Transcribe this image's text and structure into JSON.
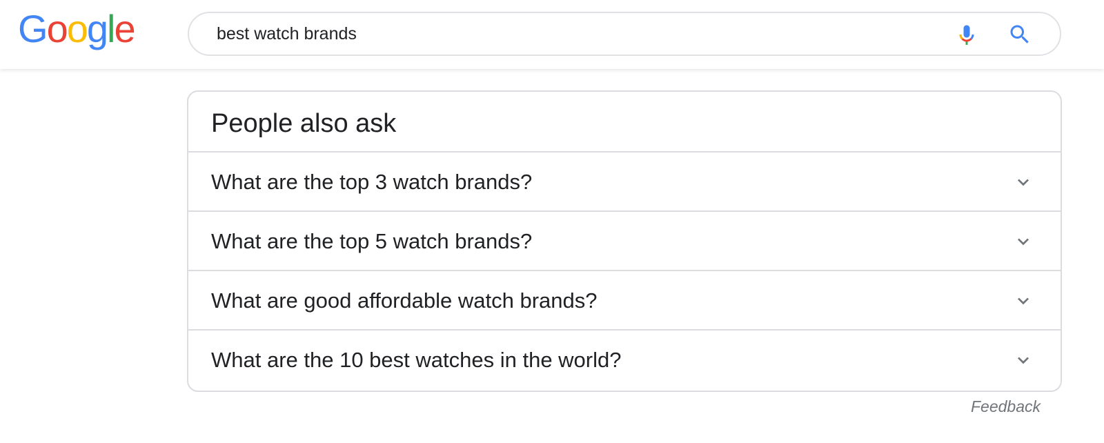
{
  "logo": {
    "letters": [
      "G",
      "o",
      "o",
      "g",
      "l",
      "e"
    ],
    "colors": [
      "#4285F4",
      "#EA4335",
      "#FBBC05",
      "#4285F4",
      "#34A853",
      "#EA4335"
    ]
  },
  "search": {
    "query": "best watch brands",
    "mic_icon": "microphone-icon",
    "search_icon": "search-icon",
    "accent": "#4285F4"
  },
  "people_also_ask": {
    "title": "People also ask",
    "questions": [
      {
        "label": "What are the top 3 watch brands?",
        "icon": "chevron-down-icon"
      },
      {
        "label": "What are the top 5 watch brands?",
        "icon": "chevron-down-icon"
      },
      {
        "label": "What are good affordable watch brands?",
        "icon": "chevron-down-icon"
      },
      {
        "label": "What are the 10 best watches in the world?",
        "icon": "chevron-down-icon"
      }
    ]
  },
  "feedback_label": "Feedback"
}
